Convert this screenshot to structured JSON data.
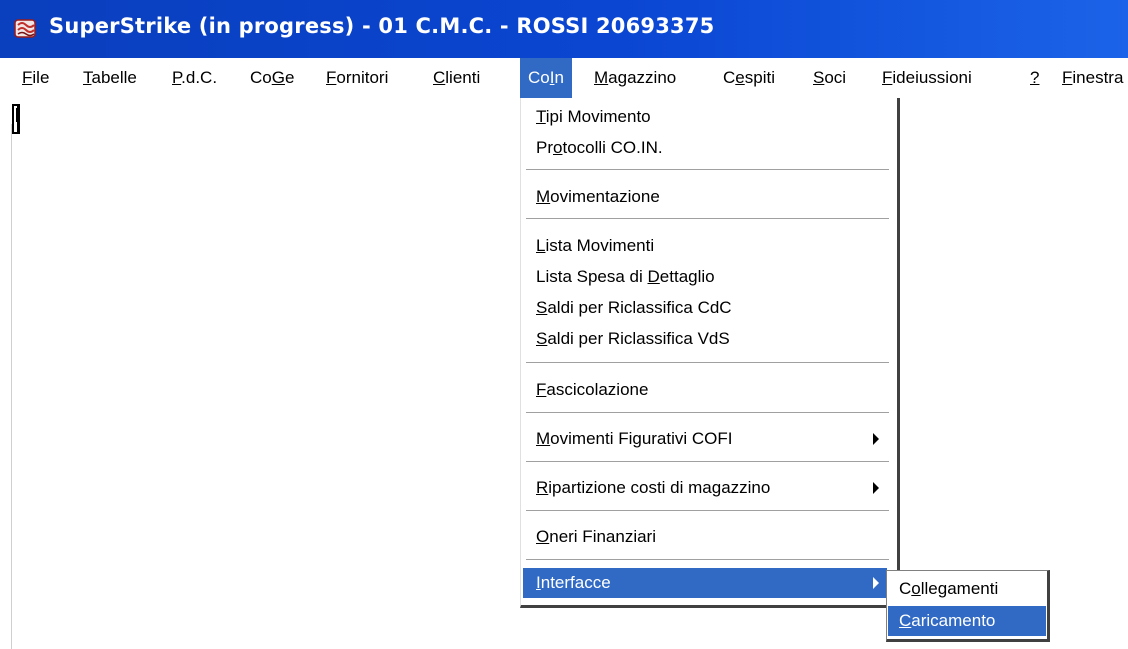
{
  "window": {
    "title": "SuperStrike (in progress) - 01 C.M.C. - ROSSI 20693375",
    "icon": "app-logo-icon",
    "accent": "#0a46d2"
  },
  "menubar": {
    "items": [
      {
        "label": "File",
        "key": "F"
      },
      {
        "label": "Tabelle",
        "key": "T"
      },
      {
        "label": "P.d.C.",
        "key": "P"
      },
      {
        "label": "CoGe",
        "key": "G"
      },
      {
        "label": "Fornitori",
        "key": "F"
      },
      {
        "label": "Clienti",
        "key": "C"
      },
      {
        "label": "CoIn",
        "key": "I",
        "active": true
      },
      {
        "label": "Magazzino",
        "key": "M"
      },
      {
        "label": "Cespiti",
        "key": "e"
      },
      {
        "label": "Soci",
        "key": "S"
      },
      {
        "label": "Fideiussioni",
        "key": "F"
      },
      {
        "label": "?",
        "key": "?"
      },
      {
        "label": "Finestra",
        "key": "F"
      }
    ],
    "highlight_color": "#316ac5"
  },
  "coin_menu": {
    "items": [
      {
        "label": "Tipi Movimento",
        "key": "T"
      },
      {
        "label": "Protocolli CO.IN.",
        "key": "o"
      },
      {
        "label": "Movimentazione",
        "key": "M"
      },
      {
        "label": "Lista Movimenti",
        "key": "L"
      },
      {
        "label": "Lista Spesa di Dettaglio",
        "key": "D"
      },
      {
        "label": "Saldi per Riclassifica CdC",
        "key": "S"
      },
      {
        "label": "Saldi per Riclassifica VdS",
        "key": "S"
      },
      {
        "label": "Fascicolazione",
        "key": "F"
      },
      {
        "label": "Movimenti Figurativi COFI",
        "key": "M",
        "submenu": true
      },
      {
        "label": "Ripartizione costi di magazzino",
        "key": "R",
        "submenu": true
      },
      {
        "label": "Oneri Finanziari",
        "key": "O"
      },
      {
        "label": "Interfacce",
        "key": "I",
        "submenu": true,
        "highlighted": true
      }
    ]
  },
  "interfacce_submenu": {
    "items": [
      {
        "label": "Collegamenti",
        "key": "o"
      },
      {
        "label": "Caricamento",
        "key": "C",
        "highlighted": true
      }
    ]
  }
}
